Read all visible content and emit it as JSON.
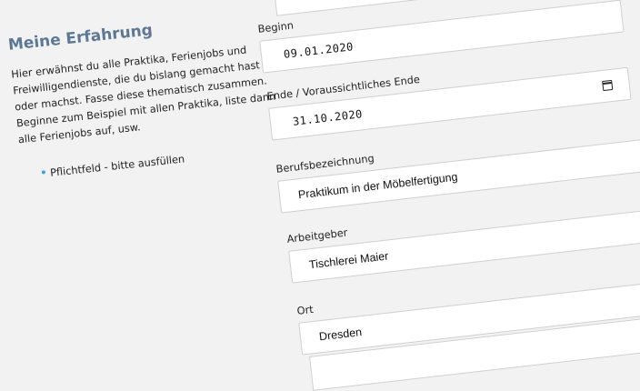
{
  "sidebar": {
    "title": "Meine Erfahrung",
    "description": "Hier erwähnst du alle Praktika, Ferienjobs und Freiwilligendienste, die du bislang gemacht hast oder machst. Fasse diese thematisch zusammen. Beginne zum Beispiel mit allen Praktika, liste dann alle Ferienjobs auf, usw.",
    "required_note": "Pflichtfeld - bitte ausfüllen"
  },
  "form": {
    "beginn": {
      "label": "Beginn",
      "value": "09.01.2020"
    },
    "ende": {
      "label": "Ende / Voraussichtliches Ende",
      "value": "31.10.2020"
    },
    "beruf": {
      "label": "Berufsbezeichnung",
      "value": "Praktikum in der Möbelfertigung"
    },
    "arbeitgeber": {
      "label": "Arbeitgeber",
      "value": "Tischlerei Maier"
    },
    "ort": {
      "label": "Ort",
      "value": "Dresden"
    }
  },
  "colors": {
    "heading": "#5c7894",
    "required_dot": "#2ea3e0",
    "background": "#f2f2f2"
  },
  "icons": {
    "date_picker": "calendar-icon",
    "required": "bullet-dot-icon"
  }
}
